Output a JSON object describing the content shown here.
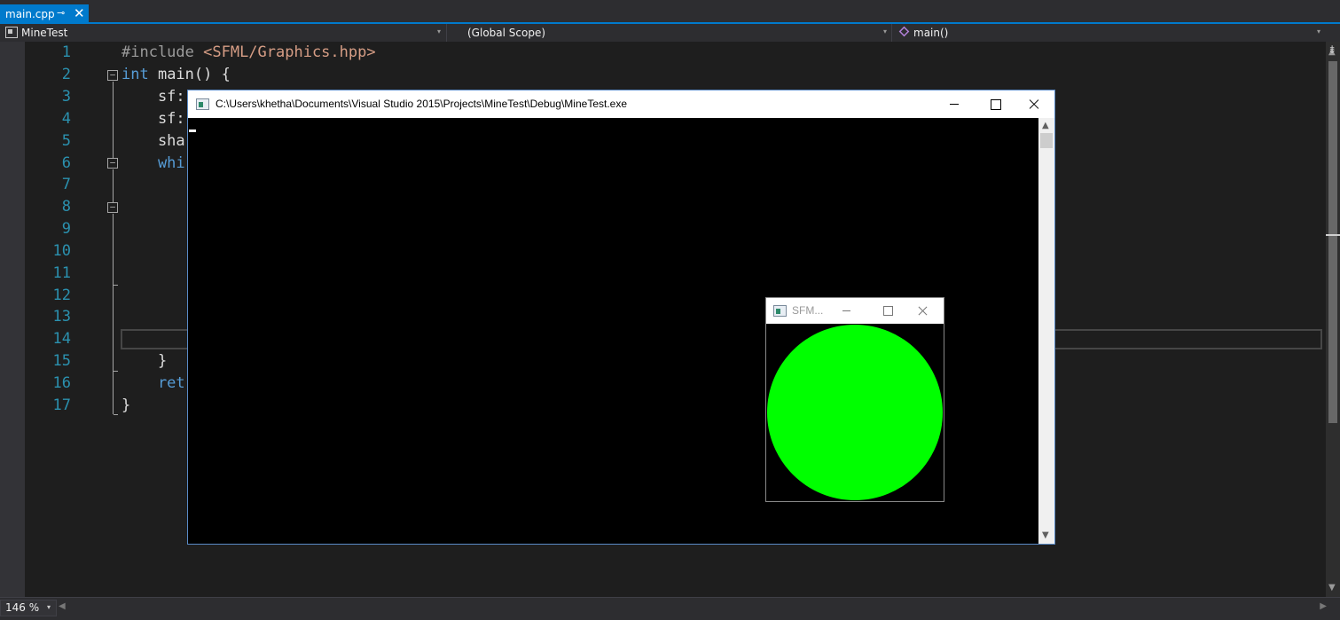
{
  "tab": {
    "title": "main.cpp",
    "pin": "⊸",
    "close": "✕"
  },
  "nav": {
    "project": "MineTest",
    "scope": "(Global Scope)",
    "function": "main()",
    "dropdown": "▾",
    "split": "⇟"
  },
  "editor": {
    "line_numbers": [
      "1",
      "2",
      "3",
      "4",
      "5",
      "6",
      "7",
      "8",
      "9",
      "10",
      "11",
      "12",
      "13",
      "14",
      "15",
      "16",
      "17"
    ],
    "lines": {
      "l1_pre": "#include ",
      "l1_str": "<SFML/Graphics.hpp>",
      "l2_kw": "int",
      "l2_rest": " main() {",
      "l3": "    sf:",
      "l4": "    sf:",
      "l5": "    sha",
      "l6_kw": "    whi",
      "l15": "    }",
      "l16_kw": "    ret",
      "l17": "}"
    },
    "fold_glyph": "−"
  },
  "scrollbar": {
    "up": "▲",
    "down": "▼"
  },
  "status": {
    "zoom": "146 %",
    "zoom_dropdown": "▾",
    "hscroll_left": "◀",
    "hscroll_right": "▶"
  },
  "console_window": {
    "title": "C:\\Users\\khetha\\Documents\\Visual Studio 2015\\Projects\\MineTest\\Debug\\MineTest.exe",
    "scroll_up": "▲",
    "scroll_down": "▼"
  },
  "sfml_window": {
    "title": "SFM...",
    "circle_color": "#00ff00"
  },
  "colors": {
    "accent": "#007acc",
    "line_number": "#2b91af",
    "keyword": "#569cd6",
    "string": "#d69d85",
    "preprocessor": "#9b9b9b"
  }
}
